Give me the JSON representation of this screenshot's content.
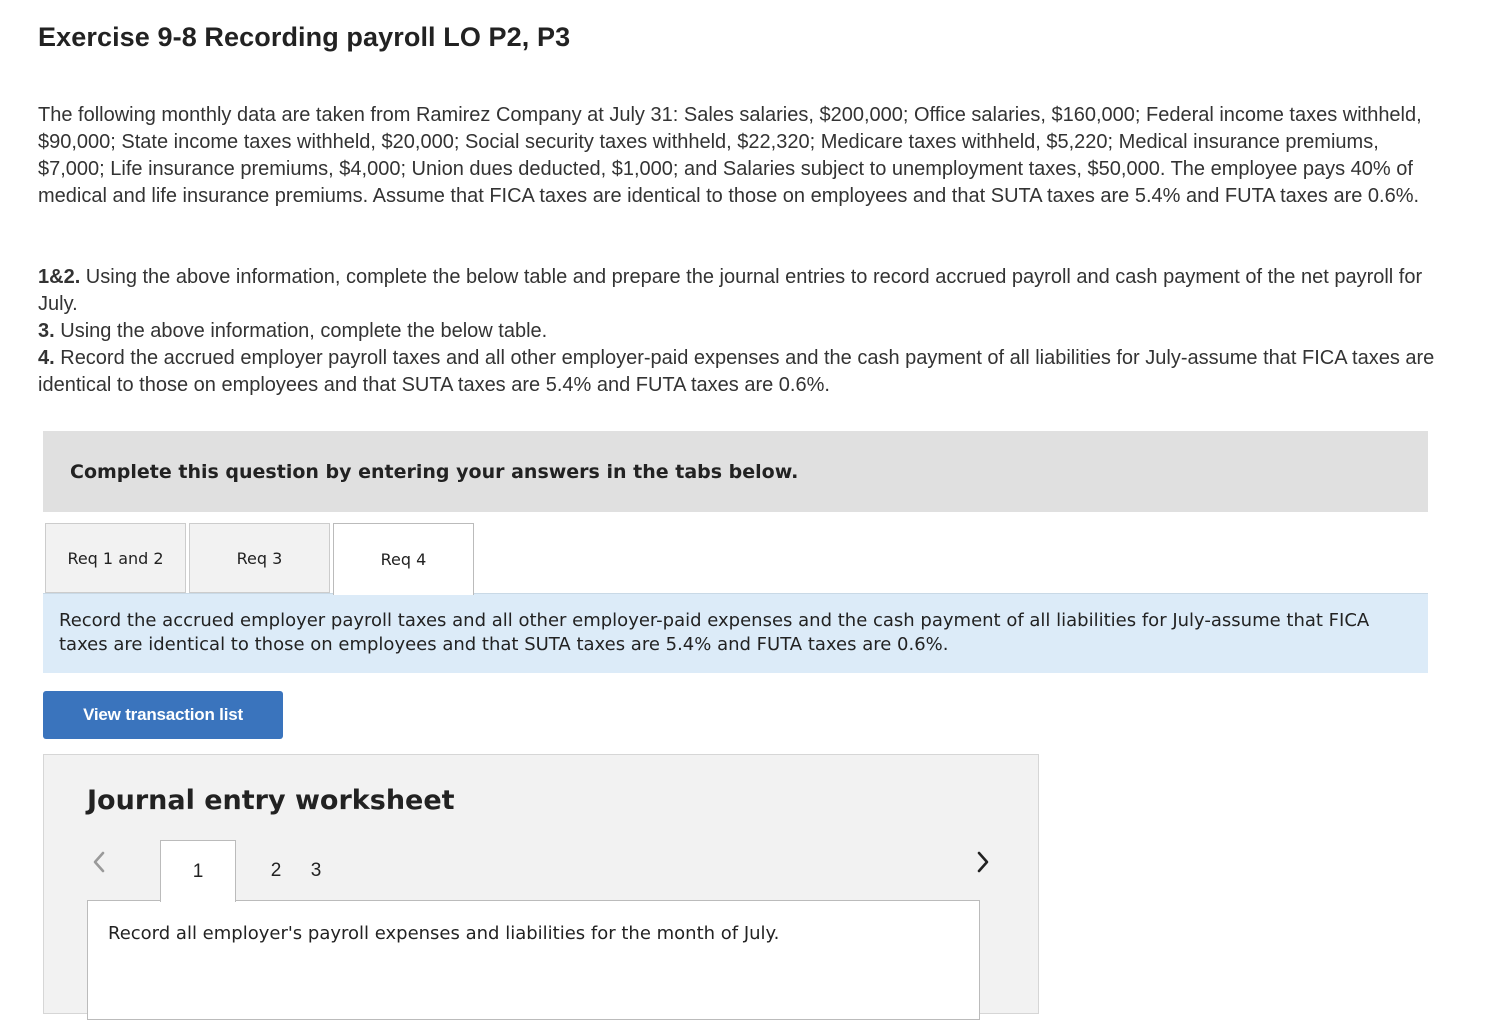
{
  "page": {
    "title": "Exercise 9-8 Recording payroll LO P2, P3",
    "intro": "The following monthly data are taken from Ramirez Company at July 31: Sales salaries, $200,000; Office salaries, $160,000; Federal income taxes withheld, $90,000; State income taxes withheld, $20,000; Social security taxes withheld, $22,320; Medicare taxes withheld, $5,220; Medical insurance premiums, $7,000; Life insurance premiums, $4,000; Union dues deducted, $1,000; and Salaries subject to unemployment taxes, $50,000. The employee pays 40% of medical and life insurance premiums. Assume that FICA taxes are identical to those on employees and that SUTA taxes are 5.4% and FUTA taxes are 0.6%.",
    "requirements": [
      {
        "num": "1&2.",
        "text": " Using the above information, complete the below table and prepare the journal entries to record accrued payroll and cash payment of the net payroll for July."
      },
      {
        "num": "3.",
        "text": " Using the above information, complete the below table."
      },
      {
        "num": "4.",
        "text": " Record the accrued employer payroll taxes and all other employer-paid expenses and the cash payment of all liabilities for July-assume that FICA taxes are identical to those on employees and that SUTA taxes are 5.4% and FUTA taxes are 0.6%."
      }
    ]
  },
  "banner": {
    "text": "Complete this question by entering your answers in the tabs below."
  },
  "tabs": [
    {
      "label": "Req 1 and 2",
      "active": false
    },
    {
      "label": "Req 3",
      "active": false
    },
    {
      "label": "Req 4",
      "active": true
    }
  ],
  "tab_content": {
    "description": "Record the accrued employer payroll taxes and all other employer-paid expenses and the cash payment of all liabilities for July-assume that FICA taxes are identical to those on employees and that SUTA taxes are 5.4% and FUTA taxes are 0.6%."
  },
  "buttons": {
    "view_transaction_list": "View transaction list"
  },
  "worksheet": {
    "title": "Journal entry worksheet",
    "pages": [
      "1",
      "2",
      "3"
    ],
    "active_page": "1",
    "instruction": "Record all employer's payroll expenses and liabilities for the month of July."
  },
  "icons": {
    "prev": "chevron-left-icon",
    "next": "chevron-right-icon"
  },
  "colors": {
    "button_bg": "#3a74bd",
    "banner_bg": "#e0e0e0",
    "description_bg": "#dcebf8",
    "worksheet_bg": "#f2f2f2"
  }
}
